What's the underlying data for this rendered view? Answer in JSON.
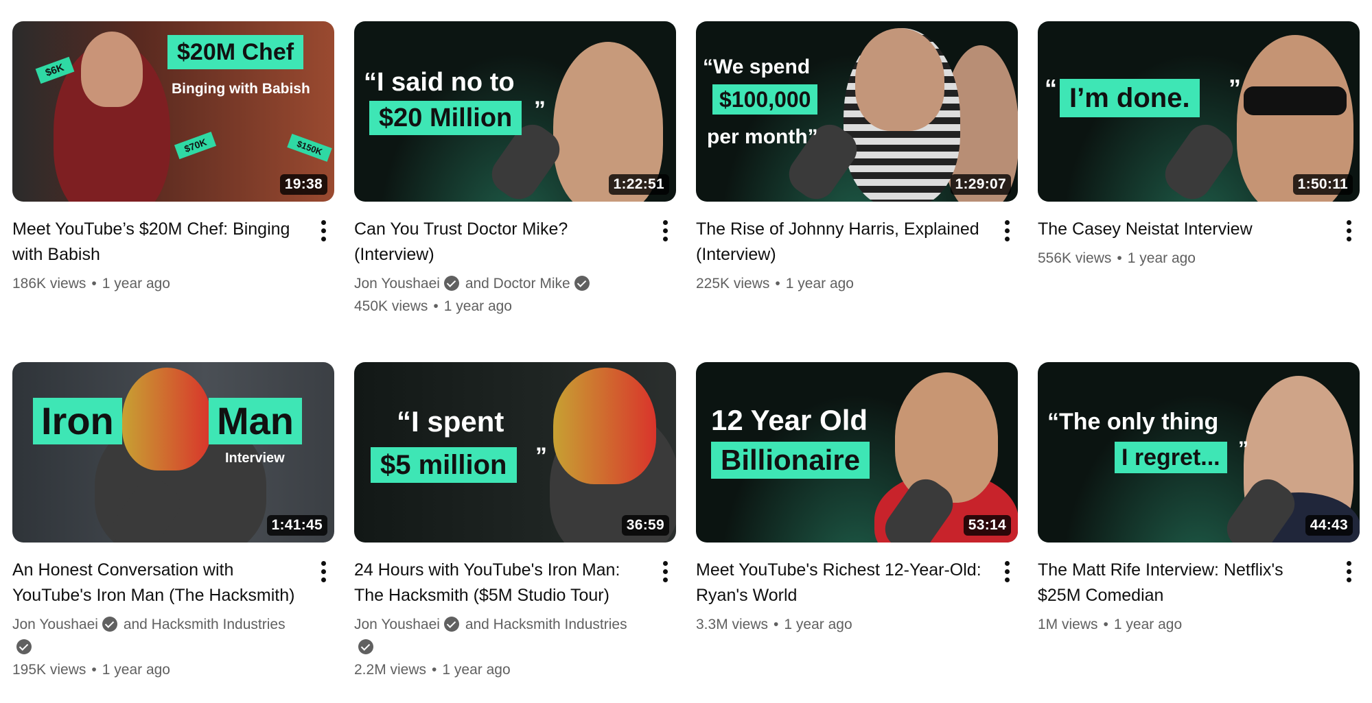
{
  "videos": [
    {
      "title": "Meet YouTube’s $20M Chef: Binging with Babish",
      "duration": "19:38",
      "channels": [],
      "views": "186K views",
      "age": "1 year ago",
      "thumb": {
        "bg": "#8a2f22",
        "tag": "$20M Chef",
        "text1": "Binging with Babish",
        "stickers": [
          "$6K",
          "$70K",
          "$150K"
        ]
      }
    },
    {
      "title": "Can You Trust Doctor Mike? (Interview)",
      "duration": "1:22:51",
      "channels": [
        "Jon Youshaei",
        "and Doctor Mike"
      ],
      "views": "450K views",
      "age": "1 year ago",
      "thumb": {
        "bg": "#0c1512",
        "text1": "“I said no to",
        "tag": "$20 Million",
        "close": "”"
      }
    },
    {
      "title": "The Rise of Johnny Harris, Explained (Interview)",
      "duration": "1:29:07",
      "channels": [],
      "views": "225K views",
      "age": "1 year ago",
      "thumb": {
        "bg": "#0b1411",
        "text1": "“We spend",
        "tag": "$100,000",
        "text2": "per month”"
      }
    },
    {
      "title": "The Casey Neistat Interview",
      "duration": "1:50:11",
      "channels": [],
      "views": "556K views",
      "age": "1 year ago",
      "thumb": {
        "bg": "#0b1411",
        "tag": "I’m done.",
        "open": "“",
        "close": "”"
      }
    },
    {
      "title": "An Honest Conversation with YouTube's Iron Man (The Hacksmith)",
      "duration": "1:41:45",
      "channels": [
        "Jon Youshaei",
        "and Hacksmith Industries"
      ],
      "views": "195K views",
      "age": "1 year ago",
      "thumb": {
        "bg": "#3b3f44",
        "tag": "Iron",
        "tag2": "Man",
        "text1": "Interview"
      }
    },
    {
      "title": "24 Hours with YouTube's Iron Man: The Hacksmith ($5M Studio Tour)",
      "duration": "36:59",
      "channels": [
        "Jon Youshaei",
        "and Hacksmith Industries"
      ],
      "views": "2.2M views",
      "age": "1 year ago",
      "thumb": {
        "bg": "#0f1513",
        "text1": "“I spent",
        "tag": "$5 million",
        "close": "”"
      }
    },
    {
      "title": "Meet YouTube's Richest 12-Year-Old: Ryan's World",
      "duration": "53:14",
      "channels": [],
      "views": "3.3M views",
      "age": "1 year ago",
      "thumb": {
        "bg": "#0b1411",
        "text1": "12 Year Old",
        "tag": "Billionaire"
      }
    },
    {
      "title": "The Matt Rife Interview: Netflix's $25M Comedian",
      "duration": "44:43",
      "channels": [],
      "views": "1M views",
      "age": "1 year ago",
      "thumb": {
        "bg": "#0b1411",
        "text1": "“The only thing",
        "tag": "I regret...",
        "close": "”"
      }
    }
  ]
}
